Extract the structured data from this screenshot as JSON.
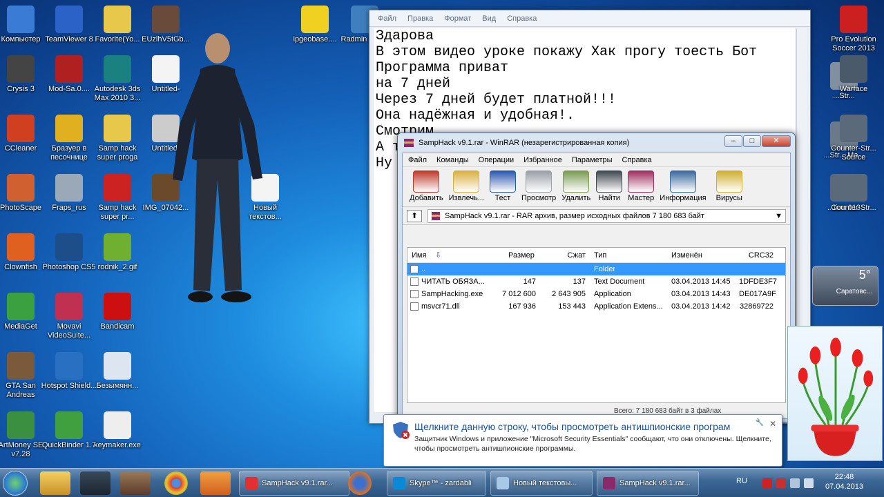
{
  "desktop": {
    "icons": [
      {
        "label": "Компьютер",
        "color": "#3a7bd5"
      },
      {
        "label": "TeamViewer 8",
        "color": "#2a62c8"
      },
      {
        "label": "Favorite(Yo...",
        "color": "#e8c84a"
      },
      {
        "label": "EUzlhV5tGb...",
        "color": "#6a4a3a"
      },
      {
        "label": "ipgeobase....",
        "color": "#f0d020"
      },
      {
        "label": "Radmin Ярлы",
        "color": "#3f7fbf"
      },
      {
        "label": "Crysis 3",
        "color": "#444444"
      },
      {
        "label": "Mod-Sa.0....",
        "color": "#b02020"
      },
      {
        "label": "Autodesk 3ds Max 2010 3...",
        "color": "#1a8080"
      },
      {
        "label": "Untitled-",
        "color": "#f4f4f4"
      },
      {
        "label": "CCleaner",
        "color": "#d04020"
      },
      {
        "label": "Бразуер в песочнице",
        "color": "#e0b020"
      },
      {
        "label": "Samp hack super proga",
        "color": "#e8c84a"
      },
      {
        "label": "Untitled-",
        "color": "#cccccc"
      },
      {
        "label": "PhotoScape",
        "color": "#d06030"
      },
      {
        "label": "Fraps_rus",
        "color": "#9aa8b8"
      },
      {
        "label": "Samp hack super pr...",
        "color": "#cc2222"
      },
      {
        "label": "IMG_07042...",
        "color": "#6a4a2a"
      },
      {
        "label": "Новый текстов...",
        "color": "#f4f4f4"
      },
      {
        "label": "Clownfish",
        "color": "#e06020"
      },
      {
        "label": "Photoshop CS5",
        "color": "#1e4e8a"
      },
      {
        "label": "rodnik_2.gif",
        "color": "#70b030"
      },
      {
        "label": "MediaGet",
        "color": "#3aa040"
      },
      {
        "label": "Movavi VideoSuite...",
        "color": "#c03050"
      },
      {
        "label": "Bandicam",
        "color": "#cc1010"
      },
      {
        "label": "GTA San Andreas",
        "color": "#7a5a3a"
      },
      {
        "label": "Hotspot Shield...",
        "color": "#2a70c0"
      },
      {
        "label": "Безымянн...",
        "color": "#dde6f0"
      },
      {
        "label": "ArtMoney SE v7.28",
        "color": "#3a9040"
      },
      {
        "label": "QuickBinder 1.7",
        "color": "#40a040"
      },
      {
        "label": "keymaker.exe",
        "color": "#eeeeee"
      },
      {
        "label": "Pro Evolution Soccer 2013",
        "color": "#cc2020"
      },
      {
        "label": "...Str...",
        "color": "#8090a0"
      },
      {
        "label": "Warface",
        "color": "#4a5a6a"
      },
      {
        "label": "...Str... Ma...",
        "color": "#6a7a8a"
      },
      {
        "label": "Counter-Str... Source",
        "color": "#5a6a7a"
      },
      {
        "label": "...tion 013",
        "color": "#5a6a7a"
      },
      {
        "label": "Counter-Str...",
        "color": "#5a6a7a"
      }
    ]
  },
  "notepad": {
    "menu": [
      "Файл",
      "Правка",
      "Формат",
      "Вид",
      "Справка"
    ],
    "text": "Здарова\nВ этом видео уроке покажу Хак прогу тоесть Бот\nПрограмма приват\nна 7 дней\nЧерез 7 дней будет платной!!!\nОна надёжная и удобная!.\nСмотрим...\nА т\nНу"
  },
  "winrar": {
    "title": "SampHack v9.1.rar - WinRAR (незарегистрированная копия)",
    "menu": [
      "Файл",
      "Команды",
      "Операции",
      "Избранное",
      "Параметры",
      "Справка"
    ],
    "toolbar": [
      {
        "label": "Добавить",
        "color": "#c03a2a"
      },
      {
        "label": "Извлечь...",
        "color": "#d9b040"
      },
      {
        "label": "Тест",
        "color": "#2a58b0"
      },
      {
        "label": "Просмотр",
        "color": "#9aa0a8"
      },
      {
        "label": "Удалить",
        "color": "#7a9a50"
      },
      {
        "label": "Найти",
        "color": "#404850"
      },
      {
        "label": "Мастер",
        "color": "#a03060"
      },
      {
        "label": "Информация",
        "color": "#3a6aa0"
      },
      {
        "label": "Вирусы",
        "color": "#d0b030"
      }
    ],
    "address": "SampHack v9.1.rar - RAR архив, размер исходных файлов 7 180 683 байт",
    "columns": {
      "name": "Имя",
      "size": "Размер",
      "packed": "Сжат",
      "type": "Тип",
      "modified": "Изменён",
      "crc": "CRC32"
    },
    "rows": [
      {
        "name": "..",
        "size": "",
        "packed": "",
        "type": "Folder",
        "modified": "",
        "crc": ""
      },
      {
        "name": "ЧИТАТЬ ОБЯЗА...",
        "size": "147",
        "packed": "137",
        "type": "Text Document",
        "modified": "03.04.2013 14:45",
        "crc": "1DFDE3F7"
      },
      {
        "name": "SampHacking.exe",
        "size": "7 012 600",
        "packed": "2 643 905",
        "type": "Application",
        "modified": "03.04.2013 14:43",
        "crc": "DE017A9F"
      },
      {
        "name": "msvcr71.dll",
        "size": "167 936",
        "packed": "153 443",
        "type": "Application Extens...",
        "modified": "03.04.2013 14:42",
        "crc": "32869722"
      }
    ],
    "status": "Всего: 7 180 683 байт в 3 файлах"
  },
  "balloon": {
    "title": "Щелкните данную строку, чтобы просмотреть антишпионские програм",
    "message": "Защитник Windows и приложение \"Microsoft Security Essentials\" сообщают, что они отключены. Щелкните, чтобы просмотреть антишпионские программы."
  },
  "weather": {
    "temp": "5°",
    "city": "Саратовс..."
  },
  "taskbar": {
    "tasks": [
      {
        "label": "SampHack v9.1.rar...",
        "color": "#e23030"
      },
      {
        "label": "Skype™ - zardabli",
        "color": "#0a8ad6"
      },
      {
        "label": "Новый текстовы...",
        "color": "#a8c8e8"
      },
      {
        "label": "SampHack v9.1.rar...",
        "color": "#8a2a6a"
      }
    ],
    "lang": "RU",
    "time": "22:48",
    "date": "07.04.2013"
  }
}
